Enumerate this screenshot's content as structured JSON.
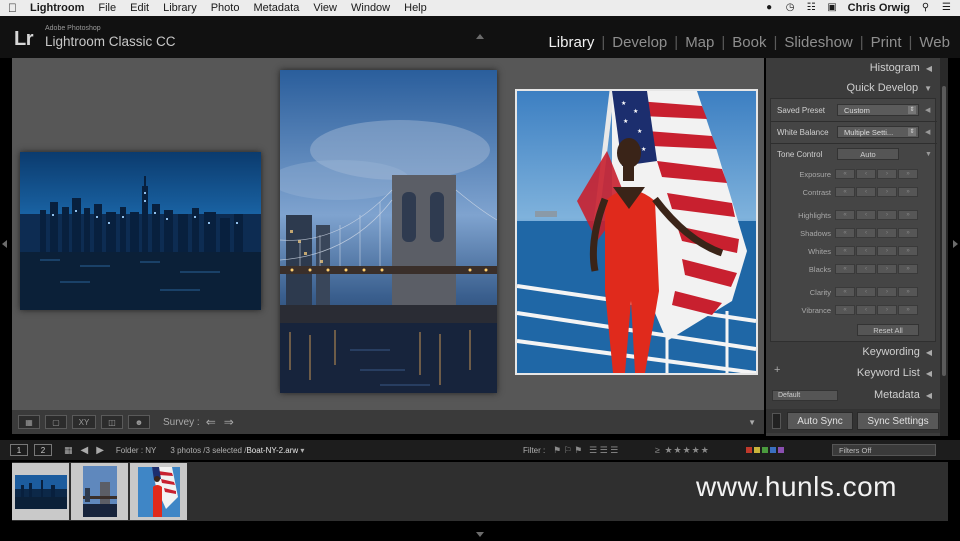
{
  "menubar": {
    "app_name": "Lightroom",
    "items": [
      "File",
      "Edit",
      "Library",
      "Photo",
      "Metadata",
      "View",
      "Window",
      "Help"
    ],
    "user": "Chris Orwig"
  },
  "identity": {
    "logo": "Lr",
    "brand_small": "Adobe Photoshop",
    "brand_big": "Lightroom Classic CC"
  },
  "modules": [
    "Library",
    "Develop",
    "Map",
    "Book",
    "Slideshow",
    "Print",
    "Web"
  ],
  "active_module": "Library",
  "toolbar": {
    "survey_label": "Survey :"
  },
  "right_panel": {
    "histogram": "Histogram",
    "quick_develop": "Quick Develop",
    "saved_preset_label": "Saved Preset",
    "saved_preset_value": "Custom",
    "white_balance_label": "White Balance",
    "white_balance_value": "Multiple Setti...",
    "tone_control_label": "Tone Control",
    "auto_label": "Auto",
    "adjustments": [
      "Exposure",
      "Contrast",
      "Highlights",
      "Shadows",
      "Whites",
      "Blacks",
      "Clarity",
      "Vibrance"
    ],
    "reset_all": "Reset All",
    "keywording": "Keywording",
    "keyword_list": "Keyword List",
    "metadata": "Metadata",
    "metadata_preset": "Default",
    "auto_sync": "Auto Sync",
    "sync_settings": "Sync Settings"
  },
  "filmstrip_bar": {
    "view1": "1",
    "view2": "2",
    "folder": "Folder : NY",
    "count": "3 photos /3 selected /",
    "file": "Boat-NY-2.arw",
    "filter_label": "Filter :",
    "filters_off": "Filters Off"
  },
  "watermark": "www.hunls.com",
  "colors": {
    "panel_bg": "#3c3c3c",
    "grid_bg": "#575757",
    "label_red": "#c0392b",
    "label_yellow": "#c9b33a",
    "label_green": "#4a9a3d",
    "label_blue": "#3a6fc0",
    "label_purple": "#8a4fb0"
  }
}
